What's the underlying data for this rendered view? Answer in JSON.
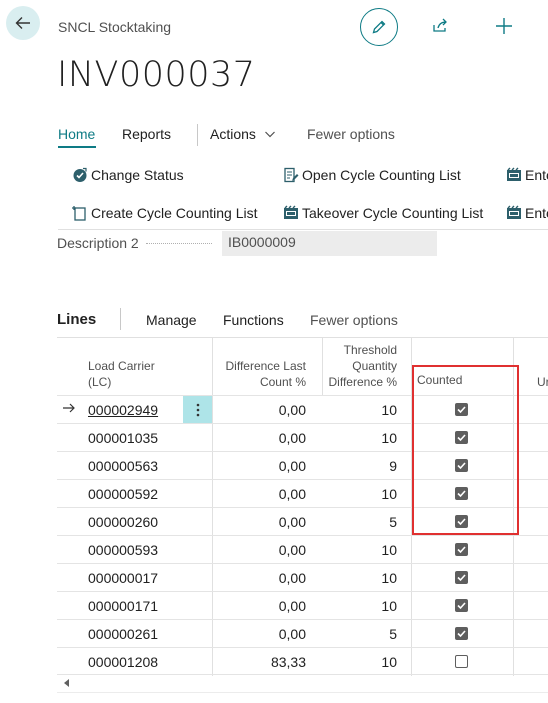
{
  "header": {
    "breadcrumb": "SNCL Stocktaking",
    "page_title": "INV000037"
  },
  "tabs": {
    "home": "Home",
    "reports": "Reports",
    "actions": "Actions",
    "fewer": "Fewer options"
  },
  "actions": [
    {
      "label": "Change Status",
      "icon": "status-check-icon"
    },
    {
      "label": "Open Cycle Counting List",
      "icon": "document-pen-icon"
    },
    {
      "label": "Ente",
      "icon": "film-icon"
    },
    {
      "label": "Create Cycle Counting List",
      "icon": "new-document-icon"
    },
    {
      "label": "Takeover Cycle Counting List",
      "icon": "film-icon"
    },
    {
      "label": "Ente",
      "icon": "film-icon"
    }
  ],
  "description2": {
    "label": "Description 2",
    "value": "IB0000009"
  },
  "lines": {
    "title": "Lines",
    "manage": "Manage",
    "functions": "Functions",
    "fewer": "Fewer options",
    "columns": {
      "load_carrier": [
        "Load Carrier",
        "(LC)"
      ],
      "difference": [
        "Difference Last",
        "Count %"
      ],
      "threshold": [
        "Threshold",
        "Quantity",
        "Difference %"
      ],
      "counted": "Counted",
      "next": "Ur"
    },
    "rows": [
      {
        "lc": "000002949",
        "diff": "0,00",
        "thr": "10",
        "counted": true
      },
      {
        "lc": "000001035",
        "diff": "0,00",
        "thr": "10",
        "counted": true
      },
      {
        "lc": "000000563",
        "diff": "0,00",
        "thr": "9",
        "counted": true
      },
      {
        "lc": "000000592",
        "diff": "0,00",
        "thr": "10",
        "counted": true
      },
      {
        "lc": "000000260",
        "diff": "0,00",
        "thr": "5",
        "counted": true
      },
      {
        "lc": "000000593",
        "diff": "0,00",
        "thr": "10",
        "counted": true
      },
      {
        "lc": "000000017",
        "diff": "0,00",
        "thr": "10",
        "counted": true
      },
      {
        "lc": "000000171",
        "diff": "0,00",
        "thr": "10",
        "counted": true
      },
      {
        "lc": "000000261",
        "diff": "0,00",
        "thr": "5",
        "counted": true
      },
      {
        "lc": "000001208",
        "diff": "83,33",
        "thr": "10",
        "counted": false
      }
    ]
  },
  "colors": {
    "accent": "#0e7b85",
    "highlight": "#e03030"
  }
}
